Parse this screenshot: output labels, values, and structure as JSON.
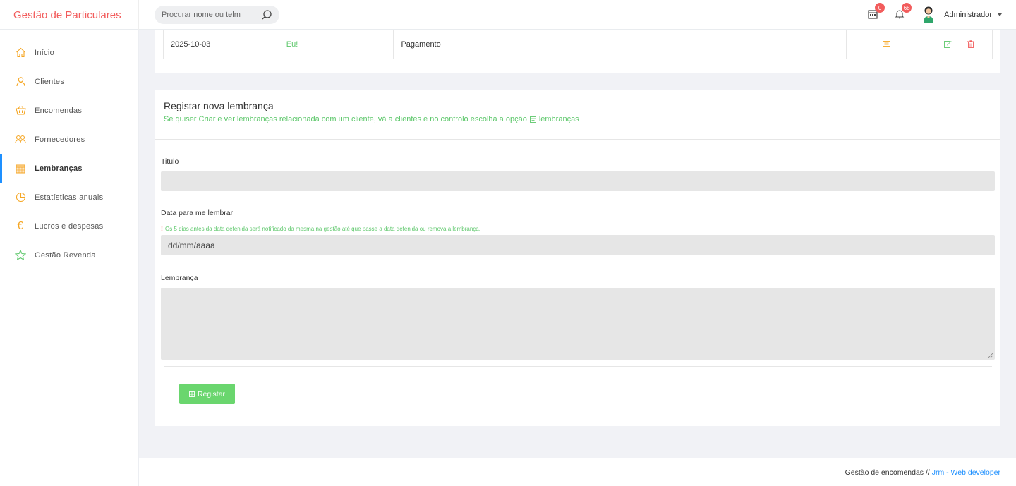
{
  "app": {
    "brand": "Gestão de Particulares"
  },
  "search": {
    "placeholder": "Procurar nome ou telm"
  },
  "header": {
    "calendar_badge": "0",
    "bell_badge": "68",
    "user_name": "Administrador"
  },
  "sidebar": {
    "items": [
      {
        "label": "Início",
        "icon": "home-icon"
      },
      {
        "label": "Clientes",
        "icon": "user-icon"
      },
      {
        "label": "Encomendas",
        "icon": "basket-icon"
      },
      {
        "label": "Fornecedores",
        "icon": "users-icon"
      },
      {
        "label": "Lembranças",
        "icon": "calendar-icon",
        "active": true
      },
      {
        "label": "Estatísticas anuais",
        "icon": "pie-chart-icon"
      },
      {
        "label": "Lucros e despesas",
        "icon": "euro-icon"
      },
      {
        "label": "Gestão Revenda",
        "icon": "star-icon"
      }
    ]
  },
  "table_row": {
    "date": "2025-10-03",
    "who": "Eu!",
    "type": "Pagamento"
  },
  "form": {
    "title": "Registar nova lembrança",
    "subtitle": "Se quiser Criar e ver lembranças relacionada com um cliente, vá a clientes e no controlo escolha a opção",
    "subtitle_link": "lembranças",
    "title_label": "Titulo",
    "date_label": "Data para me lembrar",
    "date_hint": "Os 5 dias antes da data defenida será notificado da mesma na gestão até que passe a data defenida ou remova a lembrança.",
    "date_placeholder": "dd/mm/aaaa",
    "note_label": "Lembrança",
    "submit_label": "Registar"
  },
  "footer": {
    "text": "Gestão de encomendas // ",
    "link": "Jrm - Web developer"
  },
  "colors": {
    "brand": "#f25c5c",
    "accent_green": "#6ad66e",
    "active_border": "#1e90ff",
    "icon_orange": "#f5a623"
  }
}
